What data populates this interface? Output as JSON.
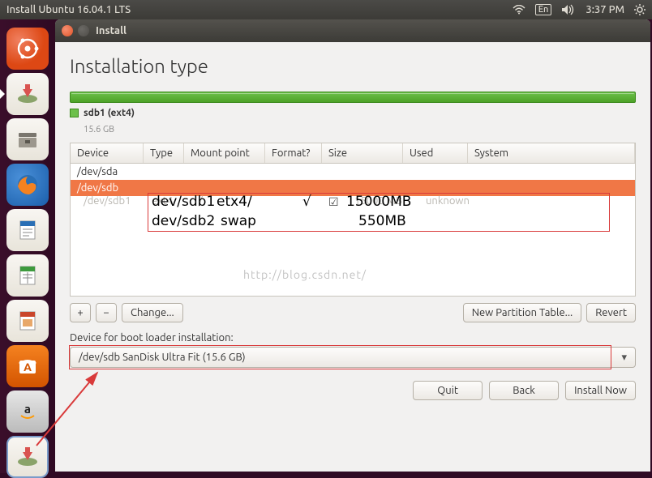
{
  "top_bar": {
    "title": "Install Ubuntu 16.04.1 LTS",
    "lang": "En",
    "time": "3:37 PM"
  },
  "window": {
    "title": "Install"
  },
  "page": {
    "heading": "Installation type"
  },
  "partition_summary": {
    "name": "sdb1 (ext4)",
    "size": "15.6 GB"
  },
  "table": {
    "headers": {
      "device": "Device",
      "type": "Type",
      "mount": "Mount point",
      "format": "Format?",
      "size": "Size",
      "used": "Used",
      "system": "System"
    },
    "rows": [
      {
        "device": "/dev/sda"
      },
      {
        "device": "/dev/sdb",
        "selected": true
      },
      {
        "device": "/dev/sdb1",
        "type": "ext4",
        "mount": "/",
        "format_check": "✓",
        "size": "15000 MB",
        "used": "unknown"
      }
    ]
  },
  "annotations": {
    "line1_dev": "dev/sdb1",
    "line1_fs": "etx4/",
    "line1_chk": "√",
    "line1_size": "15000MB",
    "line2_dev": "dev/sdb2",
    "line2_fs": "swap",
    "line2_size": "550MB"
  },
  "toolbar": {
    "add": "+",
    "remove": "−",
    "change": "Change...",
    "new_table": "New Partition Table...",
    "revert": "Revert"
  },
  "bootloader": {
    "label": "Device for boot loader installation:",
    "value": "/dev/sdb   SanDisk Ultra Fit (15.6 GB)"
  },
  "footer": {
    "quit": "Quit",
    "back": "Back",
    "install": "Install Now"
  },
  "watermark": "http://blog.csdn.net/"
}
